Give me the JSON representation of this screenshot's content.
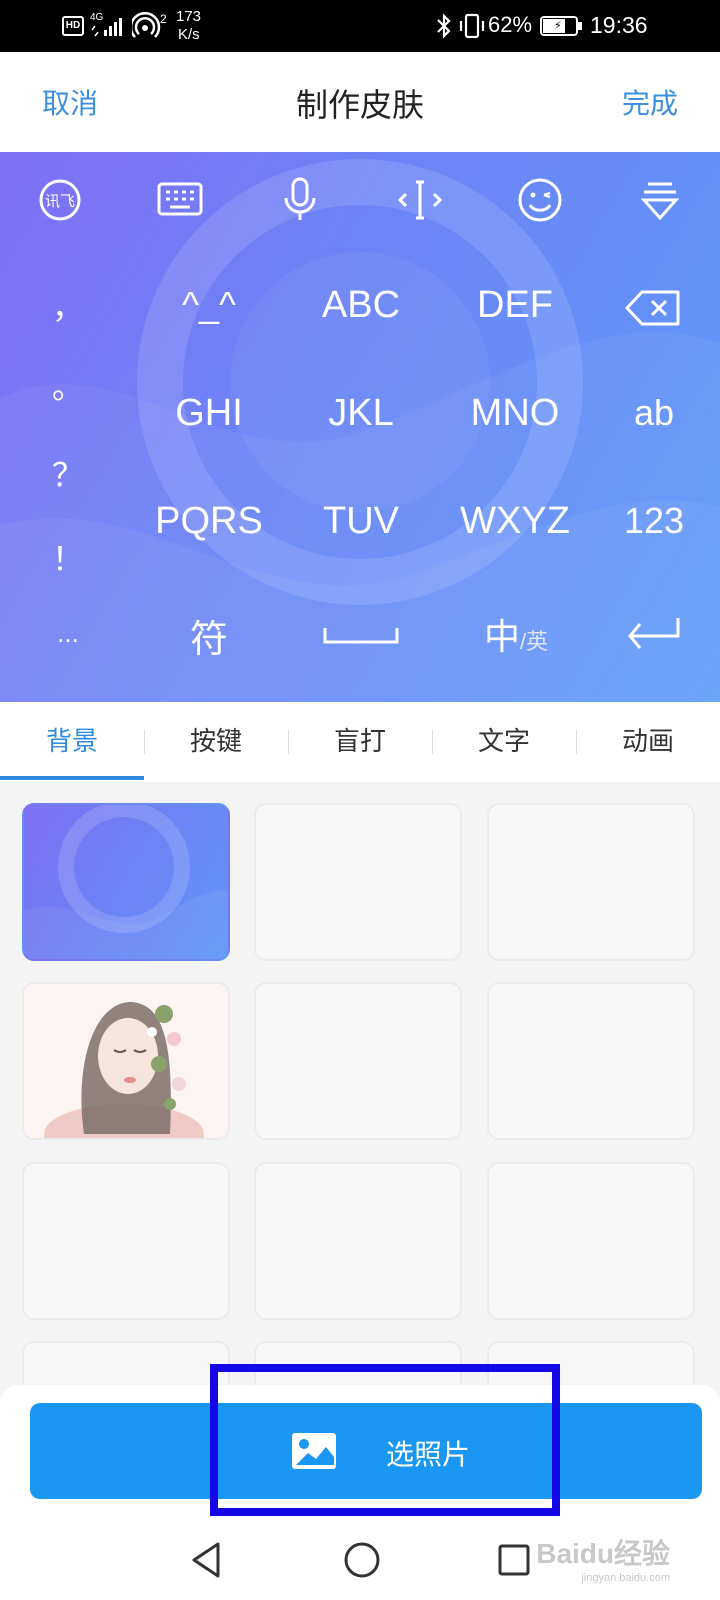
{
  "status_bar": {
    "hd": "HD",
    "network": "4G",
    "sim2": "2",
    "speed_value": "173",
    "speed_unit": "K/s",
    "battery": "62%",
    "time": "19:36"
  },
  "header": {
    "cancel_label": "取消",
    "title": "制作皮肤",
    "done_label": "完成"
  },
  "keyboard": {
    "toolbar_icons": [
      "ifly-logo-icon",
      "keyboard-icon",
      "microphone-icon",
      "cursor-move-icon",
      "emoji-icon",
      "collapse-keyboard-icon"
    ],
    "symbols": [
      "，",
      "。",
      "？",
      "！",
      "..."
    ],
    "rows": [
      [
        "^_^",
        "ABC",
        "DEF"
      ],
      [
        "GHI",
        "JKL",
        "MNO"
      ],
      [
        "PQRS",
        "TUV",
        "WXYZ"
      ]
    ],
    "right_keys": [
      "ab",
      "123"
    ],
    "bottom_keys": {
      "symbol": "符",
      "lang_main": "中",
      "lang_sub": "/英"
    }
  },
  "tabs": [
    {
      "label": "背景",
      "active": true
    },
    {
      "label": "按键",
      "active": false
    },
    {
      "label": "盲打",
      "active": false
    },
    {
      "label": "文字",
      "active": false
    },
    {
      "label": "动画",
      "active": false
    }
  ],
  "select_photo_label": "选照片",
  "watermark": {
    "text": "Baidu经验",
    "url": "jingyan.baidu.com"
  },
  "colors": {
    "accent": "#2e8be0",
    "button": "#1a96f3",
    "highlight": "#1408e6"
  }
}
